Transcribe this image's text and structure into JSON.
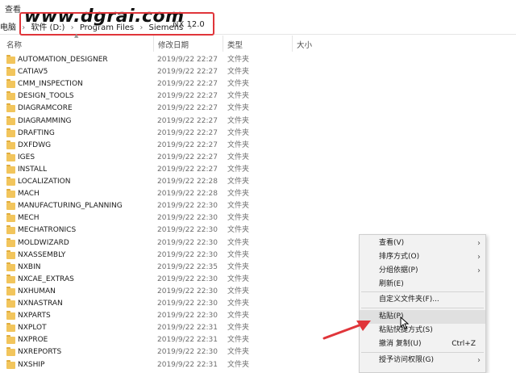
{
  "ribbon": {
    "view_tab": "查看"
  },
  "address": {
    "left_segment": "电脑",
    "segments": [
      "软件 (D:)",
      "Program Files",
      "Siemens"
    ],
    "separator": "›",
    "current": "NX 12.0",
    "current_chevron": "›"
  },
  "watermark": "www.dgrai.com",
  "columns": {
    "name": "名称",
    "date": "修改日期",
    "type": "类型",
    "size": "大小"
  },
  "files": [
    {
      "name": "AUTOMATION_DESIGNER",
      "date": "2019/9/22 22:27",
      "type": "文件夹"
    },
    {
      "name": "CATIAV5",
      "date": "2019/9/22 22:27",
      "type": "文件夹"
    },
    {
      "name": "CMM_INSPECTION",
      "date": "2019/9/22 22:27",
      "type": "文件夹"
    },
    {
      "name": "DESIGN_TOOLS",
      "date": "2019/9/22 22:27",
      "type": "文件夹"
    },
    {
      "name": "DIAGRAMCORE",
      "date": "2019/9/22 22:27",
      "type": "文件夹"
    },
    {
      "name": "DIAGRAMMING",
      "date": "2019/9/22 22:27",
      "type": "文件夹"
    },
    {
      "name": "DRAFTING",
      "date": "2019/9/22 22:27",
      "type": "文件夹"
    },
    {
      "name": "DXFDWG",
      "date": "2019/9/22 22:27",
      "type": "文件夹"
    },
    {
      "name": "IGES",
      "date": "2019/9/22 22:27",
      "type": "文件夹"
    },
    {
      "name": "INSTALL",
      "date": "2019/9/22 22:27",
      "type": "文件夹"
    },
    {
      "name": "LOCALIZATION",
      "date": "2019/9/22 22:28",
      "type": "文件夹"
    },
    {
      "name": "MACH",
      "date": "2019/9/22 22:28",
      "type": "文件夹"
    },
    {
      "name": "MANUFACTURING_PLANNING",
      "date": "2019/9/22 22:30",
      "type": "文件夹"
    },
    {
      "name": "MECH",
      "date": "2019/9/22 22:30",
      "type": "文件夹"
    },
    {
      "name": "MECHATRONICS",
      "date": "2019/9/22 22:30",
      "type": "文件夹"
    },
    {
      "name": "MOLDWIZARD",
      "date": "2019/9/22 22:30",
      "type": "文件夹"
    },
    {
      "name": "NXASSEMBLY",
      "date": "2019/9/22 22:30",
      "type": "文件夹"
    },
    {
      "name": "NXBIN",
      "date": "2019/9/22 22:35",
      "type": "文件夹"
    },
    {
      "name": "NXCAE_EXTRAS",
      "date": "2019/9/22 22:30",
      "type": "文件夹"
    },
    {
      "name": "NXHUMAN",
      "date": "2019/9/22 22:30",
      "type": "文件夹"
    },
    {
      "name": "NXNASTRAN",
      "date": "2019/9/22 22:30",
      "type": "文件夹"
    },
    {
      "name": "NXPARTS",
      "date": "2019/9/22 22:30",
      "type": "文件夹"
    },
    {
      "name": "NXPLOT",
      "date": "2019/9/22 22:31",
      "type": "文件夹"
    },
    {
      "name": "NXPROE",
      "date": "2019/9/22 22:31",
      "type": "文件夹"
    },
    {
      "name": "NXREPORTS",
      "date": "2019/9/22 22:30",
      "type": "文件夹"
    },
    {
      "name": "NXSHIP",
      "date": "2019/9/22 22:31",
      "type": "文件夹"
    }
  ],
  "context_menu": {
    "items": [
      {
        "label": "查看(V)",
        "shortcut": "",
        "submenu": true
      },
      {
        "label": "排序方式(O)",
        "shortcut": "",
        "submenu": true
      },
      {
        "label": "分组依据(P)",
        "shortcut": "",
        "submenu": true
      },
      {
        "label": "刷新(E)",
        "shortcut": "",
        "submenu": false
      },
      {
        "label": "自定义文件夹(F)...",
        "shortcut": "",
        "submenu": false
      },
      {
        "label": "粘贴(P)",
        "shortcut": "",
        "submenu": false
      },
      {
        "label": "粘贴快捷方式(S)",
        "shortcut": "",
        "submenu": false
      },
      {
        "label": "撤消 复制(U)",
        "shortcut": "Ctrl+Z",
        "submenu": false
      },
      {
        "label": "授予访问权限(G)",
        "shortcut": "",
        "submenu": true
      }
    ],
    "chevron": "›"
  },
  "colors": {
    "highlight_border": "#e0353a",
    "arrow": "#e0353a",
    "folder": "#f2c55c"
  },
  "icons": {
    "folder": "folder-icon",
    "cursor": "mouse-cursor-icon",
    "annotation": "red-arrow-icon"
  }
}
